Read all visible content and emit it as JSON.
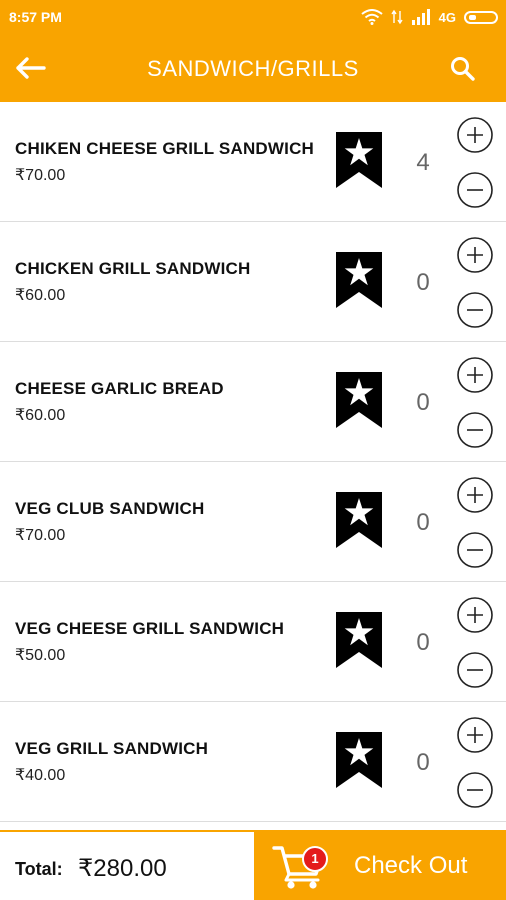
{
  "status_bar": {
    "time": "8:57 PM",
    "network": "4G",
    "icons": [
      "wifi-icon",
      "data-transfer-icon",
      "signal-icon",
      "battery-icon"
    ]
  },
  "app_bar": {
    "title": "SANDWICH/GRILLS",
    "back_icon": "arrow-left-icon",
    "search_icon": "search-icon",
    "color": "#f9a400"
  },
  "items": [
    {
      "name": "CHIKEN CHEESE GRILL SANDWICH",
      "price": "₹70.00",
      "qty": "4"
    },
    {
      "name": "CHICKEN GRILL SANDWICH",
      "price": "₹60.00",
      "qty": "0"
    },
    {
      "name": "CHEESE GARLIC BREAD",
      "price": "₹60.00",
      "qty": "0"
    },
    {
      "name": "VEG CLUB SANDWICH",
      "price": "₹70.00",
      "qty": "0"
    },
    {
      "name": "VEG CHEESE GRILL SANDWICH",
      "price": "₹50.00",
      "qty": "0"
    },
    {
      "name": "VEG GRILL SANDWICH",
      "price": "₹40.00",
      "qty": "0"
    }
  ],
  "footer": {
    "total_label": "Total:",
    "total_value": "₹280.00",
    "cart_badge": "1",
    "checkout_label": "Check Out",
    "cart_icon": "shopping-cart-icon"
  },
  "colors": {
    "accent": "#f9a400",
    "badge": "#e41b1b"
  }
}
